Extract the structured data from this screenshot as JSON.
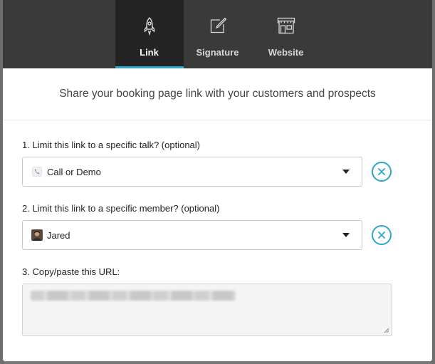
{
  "tabs": [
    {
      "label": "Link",
      "icon": "rocket-icon",
      "active": true
    },
    {
      "label": "Signature",
      "icon": "pencil-square-icon",
      "active": false
    },
    {
      "label": "Website",
      "icon": "storefront-icon",
      "active": false
    }
  ],
  "intro": "Share your booking page link with your customers and prospects",
  "fields": {
    "talk": {
      "label": "1. Limit this link to a specific talk? (optional)",
      "value": "Call or Demo",
      "icon": "phone-icon"
    },
    "member": {
      "label": "2. Limit this link to a specific member? (optional)",
      "value": "Jared",
      "icon": "avatar"
    },
    "url": {
      "label": "3. Copy/paste this URL:"
    }
  },
  "colors": {
    "accent": "#2fa6c6",
    "header": "#3a3a3a",
    "active_tab": "#242424"
  }
}
